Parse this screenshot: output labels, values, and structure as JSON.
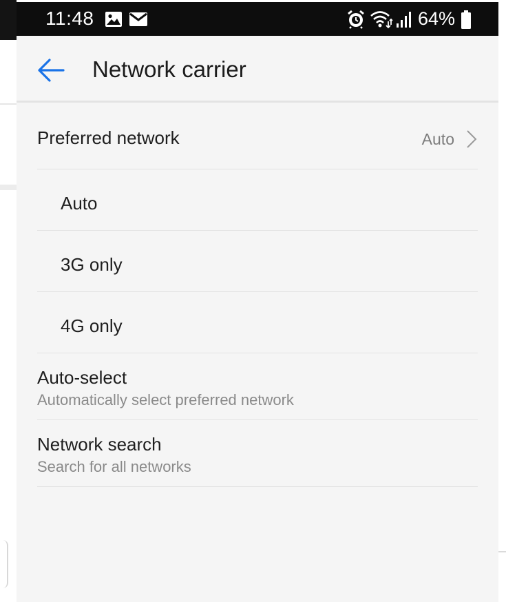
{
  "status_bar": {
    "time": "11:48",
    "battery_percent": "64%",
    "icons": [
      "image-notification-icon",
      "mail-notification-icon",
      "alarm-icon",
      "wifi-icon",
      "signal-icon",
      "battery-icon"
    ]
  },
  "app_bar": {
    "title": "Network carrier",
    "back_icon": "arrow-left-icon"
  },
  "preferred_network": {
    "label": "Preferred network",
    "value": "Auto",
    "options": [
      "Auto",
      "3G only",
      "4G only"
    ]
  },
  "auto_select": {
    "title": "Auto-select",
    "subtitle": "Automatically select preferred network"
  },
  "network_search": {
    "title": "Network search",
    "subtitle": "Search for all networks"
  },
  "colors": {
    "accent": "#1a73e8",
    "background": "#f5f5f5",
    "status_bar": "#0d0d0d",
    "divider": "#e2e2e2"
  }
}
